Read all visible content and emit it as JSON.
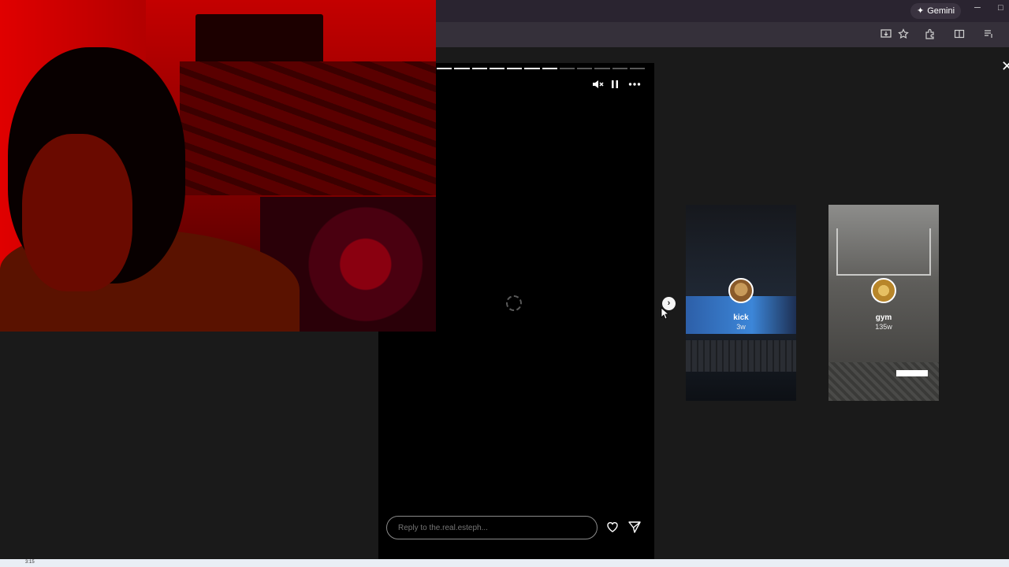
{
  "browser": {
    "gemini_label": "Gemini",
    "minimize_glyph": "─",
    "restore_glyph": "□"
  },
  "story": {
    "close_glyph": "✕",
    "progress": {
      "segments": 12,
      "completed": 7
    },
    "controls": [
      "mute-icon",
      "pause-icon",
      "more-icon"
    ],
    "reply_placeholder": "Reply to the.real.esteph...",
    "reply_actions": [
      "heart-icon",
      "send-icon"
    ],
    "next_glyph": "›"
  },
  "previews": [
    {
      "username": "kick",
      "time": "3w"
    },
    {
      "username": "gym",
      "time": "135w"
    }
  ],
  "taskbar": {
    "tray_text": "3:15"
  },
  "colors": {
    "page_bg": "#1a1a1a",
    "story_bg": "#000000",
    "titlebar": "#2a2430",
    "toolbar": "#35303a",
    "webcam_red": "#c40000"
  }
}
